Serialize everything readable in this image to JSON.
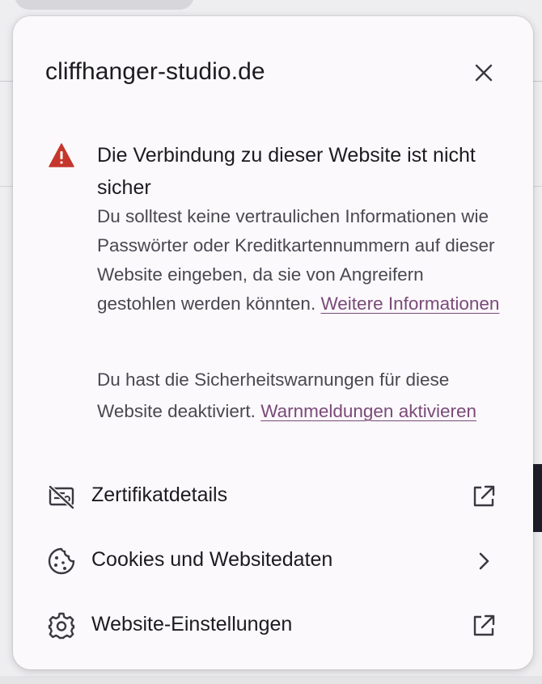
{
  "background": {
    "tab_text": "...................."
  },
  "panel": {
    "title": "cliffhanger-studio.de",
    "warning": {
      "title": "Die Verbindung zu dieser Website ist nicht sicher",
      "body": "Du solltest keine vertraulichen Informationen wie Passwörter oder Kreditkartennummern auf dieser Website eingeben, da sie von Angreifern gestohlen werden könnten.",
      "more_info_link": "Weitere Informationen",
      "disabled_text": "Du hast die Sicherheitswarnungen für diese Website deaktiviert.",
      "enable_link": "Warnmeldungen aktivieren"
    },
    "rows": [
      {
        "label": "Zertifikatdetails",
        "icon": "certificate-invalid-icon",
        "trailing": "external-link-icon"
      },
      {
        "label": "Cookies und Websitedaten",
        "icon": "cookie-icon",
        "trailing": "chevron-right-icon"
      },
      {
        "label": "Website-Einstellungen",
        "icon": "gear-icon",
        "trailing": "external-link-icon"
      }
    ],
    "colors": {
      "warning_red": "#c5372c",
      "link": "#7a4a78",
      "panel_bg": "#fbf9fc"
    }
  }
}
